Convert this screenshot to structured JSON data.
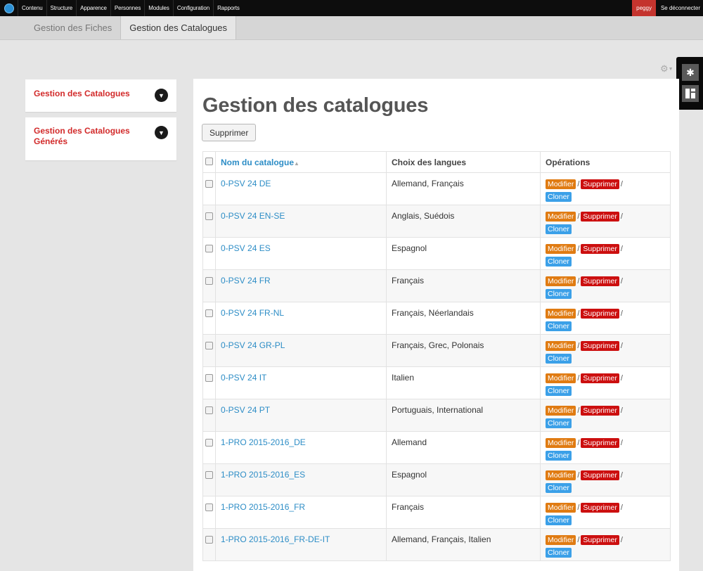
{
  "admin_bar": {
    "menu": [
      "Contenu",
      "Structure",
      "Apparence",
      "Personnes",
      "Modules",
      "Configuration",
      "Rapports"
    ],
    "user": "peggy",
    "logout": "Se déconnecter"
  },
  "tabs": [
    {
      "label": "Gestion des Fiches",
      "active": false
    },
    {
      "label": "Gestion des Catalogues",
      "active": true
    }
  ],
  "icons": {
    "gear": "gear-icon",
    "settings": "settings-icon",
    "layout": "layout-icon"
  },
  "sidebar": {
    "blocks": [
      {
        "label": "Gestion des Catalogues"
      },
      {
        "label": "Gestion des Catalogues Générés"
      }
    ]
  },
  "main": {
    "title": "Gestion des catalogues",
    "delete_button": "Supprimer",
    "columns": {
      "name": "Nom du catalogue",
      "languages": "Choix des langues",
      "operations": "Opérations"
    },
    "ops": {
      "edit": "Modifier",
      "delete": "Supprimer",
      "clone": "Cloner",
      "sep": "/"
    },
    "rows": [
      {
        "name": "0-PSV 24 DE",
        "languages": "Allemand, Français"
      },
      {
        "name": "0-PSV 24 EN-SE",
        "languages": "Anglais, Suédois"
      },
      {
        "name": "0-PSV 24 ES",
        "languages": "Espagnol"
      },
      {
        "name": "0-PSV 24 FR",
        "languages": "Français"
      },
      {
        "name": "0-PSV 24 FR-NL",
        "languages": "Français, Néerlandais"
      },
      {
        "name": "0-PSV 24 GR-PL",
        "languages": "Français, Grec, Polonais"
      },
      {
        "name": "0-PSV 24 IT",
        "languages": "Italien"
      },
      {
        "name": "0-PSV 24 PT",
        "languages": "Portuguais, International"
      },
      {
        "name": "1-PRO 2015-2016_DE",
        "languages": "Allemand"
      },
      {
        "name": "1-PRO 2015-2016_ES",
        "languages": "Espagnol"
      },
      {
        "name": "1-PRO 2015-2016_FR",
        "languages": "Français"
      },
      {
        "name": "1-PRO 2015-2016_FR-DE-IT",
        "languages": "Allemand, Français, Italien"
      }
    ]
  },
  "colors": {
    "admin_bar": "#0d0d0d",
    "user_badge": "#c4342e",
    "sidebar_link": "#d22a2a",
    "link": "#2d8dc6",
    "badge_edit": "#e07b12",
    "badge_delete": "#cc0f0f",
    "badge_clone": "#3ba0e8"
  }
}
